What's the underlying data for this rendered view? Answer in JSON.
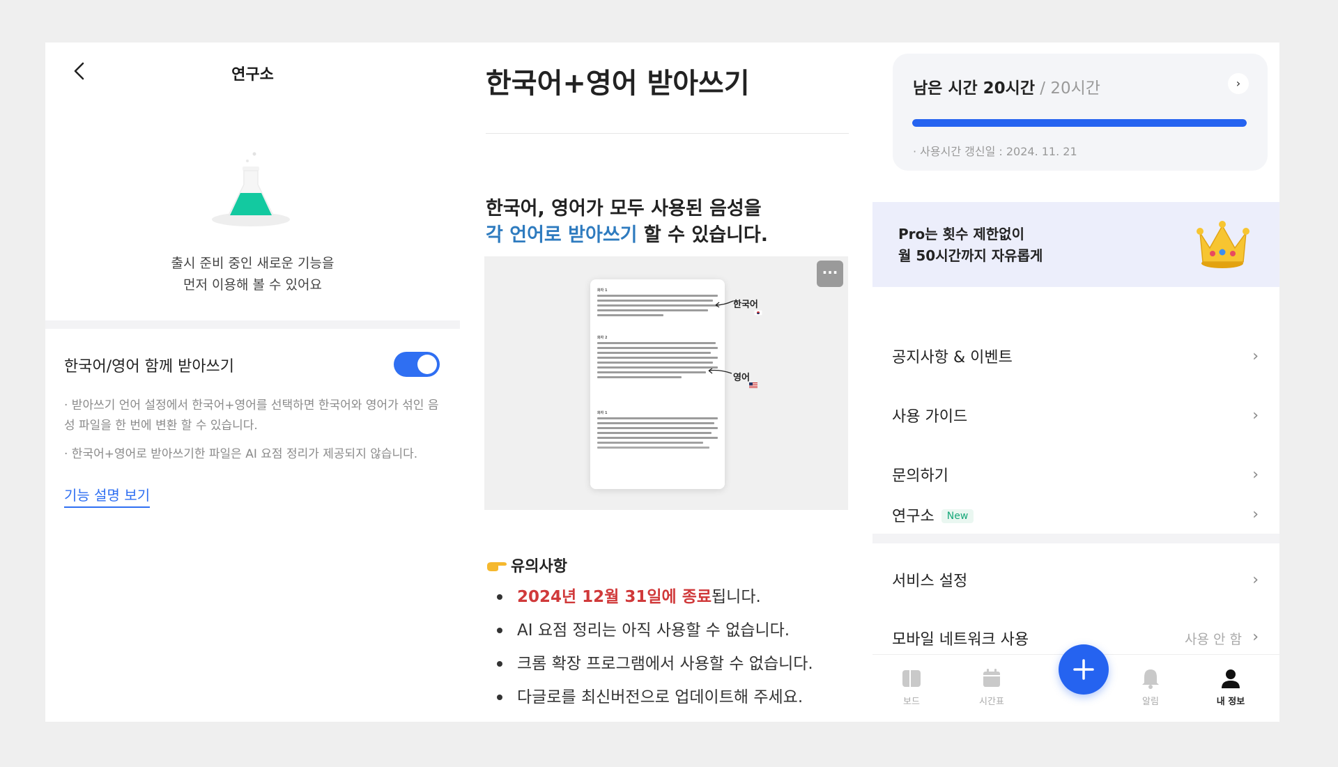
{
  "lab": {
    "title": "연구소",
    "intro_line1": "출시 준비 중인 새로운 기능을",
    "intro_line2": "먼저 이용해 볼 수 있어요",
    "toggle_label": "한국어/영어 함께 받아쓰기",
    "toggle_on": true,
    "note1": "· 받아쓰기 언어 설정에서 한국어+영어를 선택하면 한국어와 영어가 섞인 음성 파일을 한 번에 변환 할 수 있습니다.",
    "note2": "· 한국어+영어로 받아쓰기한 파일은 AI 요점 정리가 제공되지 않습니다.",
    "link": "기능 설명 보기"
  },
  "guide": {
    "heading": "한국어+영어 받아쓰기",
    "lead_line1": "한국어, 영어가 모두 사용된 음성을",
    "lead_highlight": "각 언어로 받아쓰기",
    "lead_rest": " 할 수 있습니다.",
    "preview": {
      "more_icon": "···",
      "speakers": [
        "화자 1",
        "화자 2",
        "화자 1"
      ],
      "tag_korean": "한국어",
      "tag_english": "영어"
    },
    "caution_title": "유의사항",
    "items": [
      {
        "highlight": "2024년 12월 31일에 종료",
        "rest": "됩니다."
      },
      {
        "highlight": "",
        "rest": "AI 요점 정리는 아직 사용할 수 없습니다."
      },
      {
        "highlight": "",
        "rest": "크롬 확장 프로그램에서 사용할 수 없습니다."
      },
      {
        "highlight": "",
        "rest": "다글로를 최신버전으로 업데이트해 주세요."
      }
    ]
  },
  "account": {
    "remaining": "남은 시간 20시간",
    "total": " / 20시간",
    "progress": 1.0,
    "renew": "· 사용시간 갱신일 : 2024. 11. 21",
    "promo_line1": "Pro는 횟수 제한없이",
    "promo_line2": "월 50시간까지 자유롭게",
    "menu": [
      {
        "label": "공지사항 & 이벤트"
      },
      {
        "label": "사용 가이드"
      },
      {
        "label": "문의하기"
      },
      {
        "label": "연구소",
        "badge": "New"
      },
      {
        "label": "서비스 설정"
      },
      {
        "label": "모바일 네트워크 사용",
        "value": "사용 안 함"
      }
    ],
    "tabs": [
      {
        "label": "보드",
        "icon": "board-icon"
      },
      {
        "label": "시간표",
        "icon": "calendar-icon"
      },
      {
        "label": "알림",
        "icon": "bell-icon"
      },
      {
        "label": "내 정보",
        "icon": "person-icon"
      }
    ],
    "accent": "#2563f0"
  }
}
